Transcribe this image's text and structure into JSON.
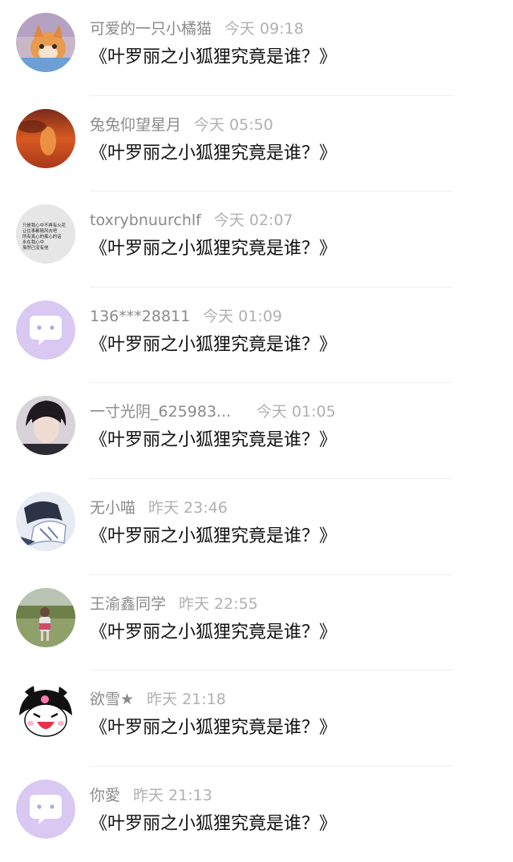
{
  "comments": [
    {
      "username": "可爱的一只小橘猫",
      "time": "今天 09:18",
      "text": "《叶罗丽之小狐狸究竟是谁？》",
      "avatar": "kitten-avatar"
    },
    {
      "username": "兔兔仰望星月",
      "time": "今天 05:50",
      "text": "《叶罗丽之小狐狸究竟是谁？》",
      "avatar": "sunset-avatar"
    },
    {
      "username": "toxrybnuurchlf",
      "time": "今天 02:07",
      "text": "《叶罗丽之小狐狸究竟是谁？》",
      "avatar": "text-avatar",
      "avatar_text": [
        "只是我心中不再有火花",
        "让往事都随风去吧",
        "所有真心的痴心的话",
        "永在我心中",
        "虽然已没有他"
      ]
    },
    {
      "username": "136***28811",
      "time": "今天 01:09",
      "text": "《叶罗丽之小狐狸究竟是谁？》",
      "avatar": "default-avatar"
    },
    {
      "username": "一寸光阴_625983...",
      "time": "今天 01:05",
      "text": "《叶罗丽之小狐狸究竟是谁？》",
      "avatar": "person-avatar"
    },
    {
      "username": "无小喵",
      "time": "昨天 23:46",
      "text": "《叶罗丽之小狐狸究竟是谁？》",
      "avatar": "anime-avatar"
    },
    {
      "username": "王渝鑫同学",
      "time": "昨天 22:55",
      "text": "《叶罗丽之小狐狸究竟是谁？》",
      "avatar": "child-avatar"
    },
    {
      "username": "欲雪★",
      "time": "昨天 21:18",
      "text": "《叶罗丽之小狐狸究竟是谁？》",
      "avatar": "kuromi-avatar"
    },
    {
      "username": "你愛",
      "time": "昨天 21:13",
      "text": "《叶罗丽之小狐狸究竟是谁？》",
      "avatar": "default-avatar"
    }
  ],
  "colors": {
    "username": "#8a8a8a",
    "time": "#b0b0b0",
    "text": "#111111",
    "default_avatar_bg": "#d9c8f2"
  }
}
